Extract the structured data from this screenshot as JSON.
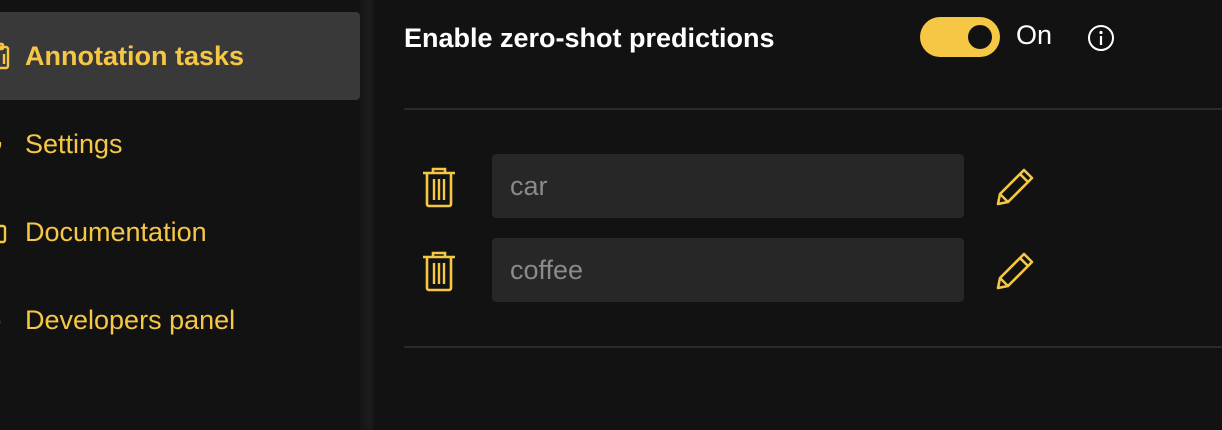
{
  "sidebar": {
    "items": [
      {
        "label": "Annotation tasks",
        "icon": "clipboard-icon",
        "active": true
      },
      {
        "label": "Settings",
        "icon": "gear-icon",
        "active": false
      },
      {
        "label": "Documentation",
        "icon": "book-icon",
        "active": false
      },
      {
        "label": "Developers panel",
        "icon": "code-icon",
        "active": false
      }
    ]
  },
  "zero_shot": {
    "title": "Enable zero-shot predictions",
    "toggle_state": "On",
    "enabled": true,
    "info_icon": "info-icon"
  },
  "labels": [
    {
      "placeholder": "car",
      "delete_icon": "trash-icon",
      "edit_icon": "pencil-icon"
    },
    {
      "placeholder": "coffee",
      "delete_icon": "trash-icon",
      "edit_icon": "pencil-icon"
    }
  ],
  "colors": {
    "accent": "#f6c744",
    "background": "#121212",
    "input_background": "#272727",
    "active_item_background": "#393939",
    "text_primary": "#ffffff",
    "text_muted": "#8a8a8a"
  }
}
